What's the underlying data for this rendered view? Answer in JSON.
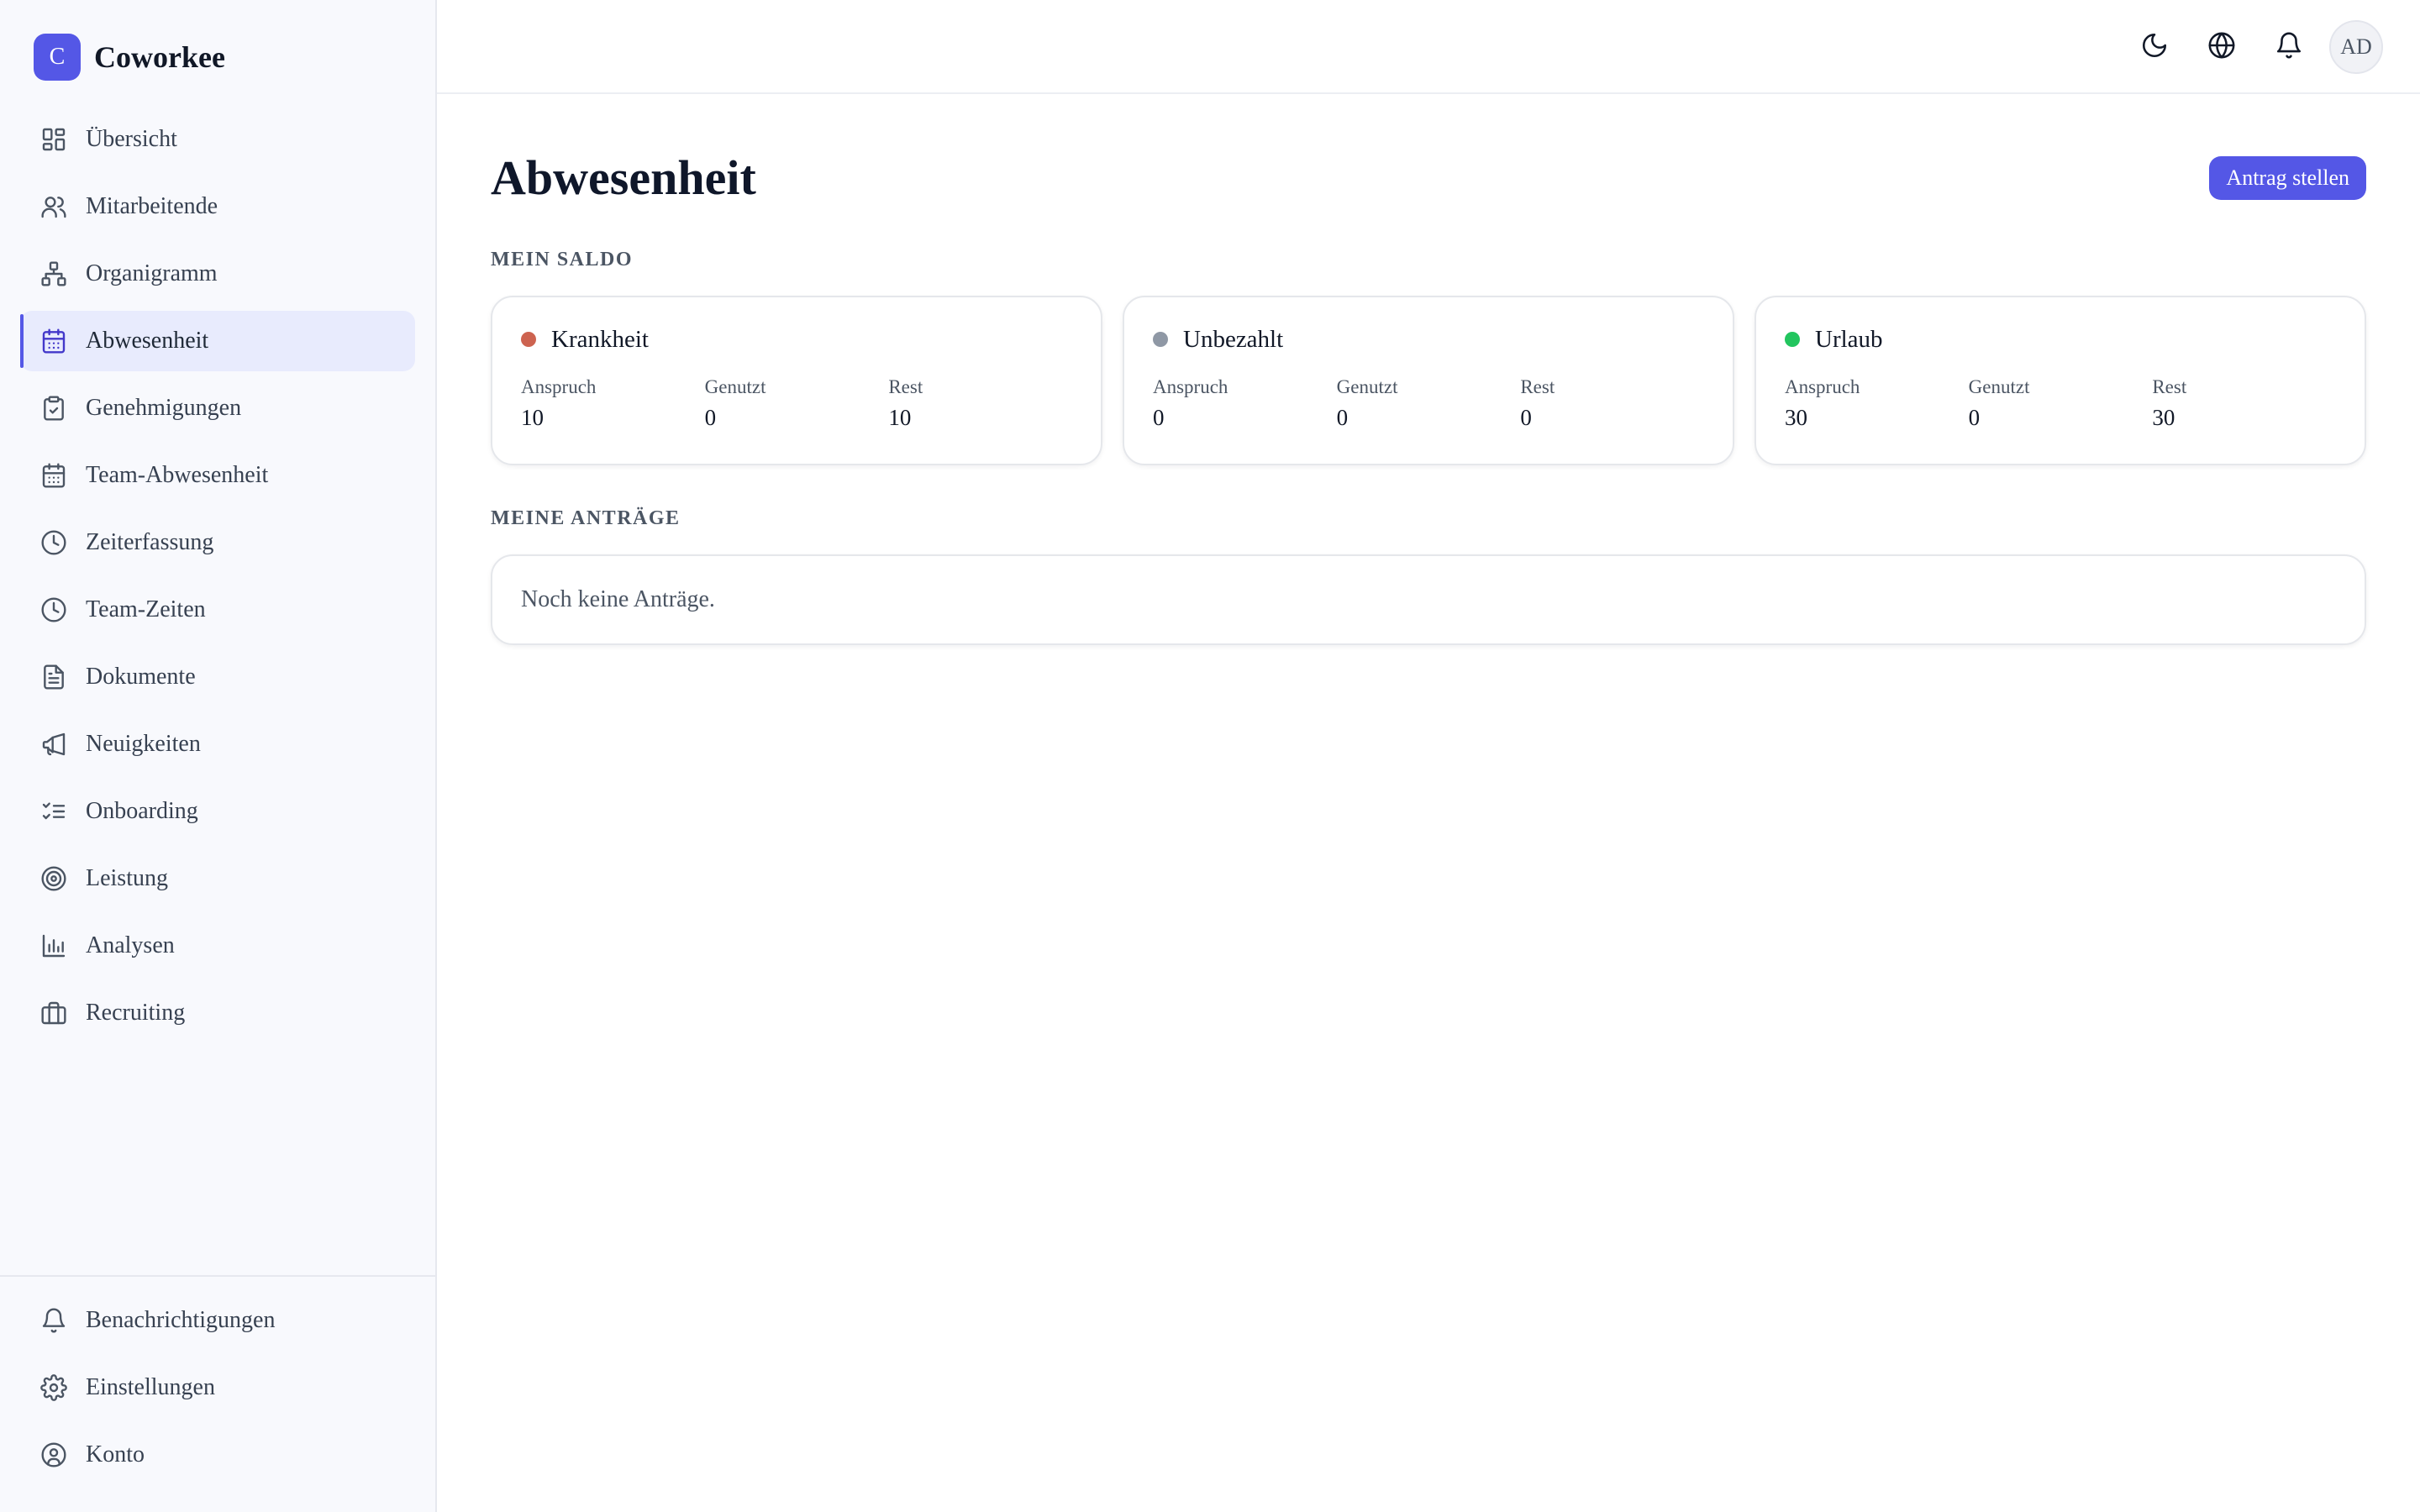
{
  "brand": {
    "logo_letter": "C",
    "name": "Coworkee",
    "accent": "#5457e6"
  },
  "sidebar": {
    "items": [
      {
        "label": "Übersicht",
        "icon": "dashboard-icon"
      },
      {
        "label": "Mitarbeitende",
        "icon": "users-icon"
      },
      {
        "label": "Organigramm",
        "icon": "org-chart-icon"
      },
      {
        "label": "Abwesenheit",
        "icon": "calendar-icon",
        "active": true
      },
      {
        "label": "Genehmigungen",
        "icon": "clipboard-check-icon"
      },
      {
        "label": "Team-Abwesenheit",
        "icon": "calendar-icon"
      },
      {
        "label": "Zeiterfassung",
        "icon": "clock-icon"
      },
      {
        "label": "Team-Zeiten",
        "icon": "clock-icon"
      },
      {
        "label": "Dokumente",
        "icon": "document-icon"
      },
      {
        "label": "Neuigkeiten",
        "icon": "megaphone-icon"
      },
      {
        "label": "Onboarding",
        "icon": "checklist-icon"
      },
      {
        "label": "Leistung",
        "icon": "target-icon"
      },
      {
        "label": "Analysen",
        "icon": "bar-chart-icon"
      },
      {
        "label": "Recruiting",
        "icon": "briefcase-icon"
      }
    ],
    "footer_items": [
      {
        "label": "Benachrichtigungen",
        "icon": "bell-icon"
      },
      {
        "label": "Einstellungen",
        "icon": "gear-icon"
      },
      {
        "label": "Konto",
        "icon": "user-circle-icon"
      }
    ]
  },
  "header": {
    "icons": [
      "moon-icon",
      "globe-icon",
      "bell-icon"
    ],
    "avatar_initials": "AD"
  },
  "main": {
    "title": "Abwesenheit",
    "action_button": "Antrag stellen",
    "balance_section_label": "MEIN SALDO",
    "requests_section_label": "MEINE ANTRÄGE",
    "empty_requests_text": "Noch keine Anträge.",
    "stat_labels": {
      "entitlement": "Anspruch",
      "used": "Genutzt",
      "remaining": "Rest"
    },
    "balances": [
      {
        "name": "Krankheit",
        "color": "#cd6350",
        "entitlement": "10",
        "used": "0",
        "remaining": "10"
      },
      {
        "name": "Unbezahlt",
        "color": "#8f98a5",
        "entitlement": "0",
        "used": "0",
        "remaining": "0"
      },
      {
        "name": "Urlaub",
        "color": "#22c55e",
        "entitlement": "30",
        "used": "0",
        "remaining": "30"
      }
    ]
  }
}
